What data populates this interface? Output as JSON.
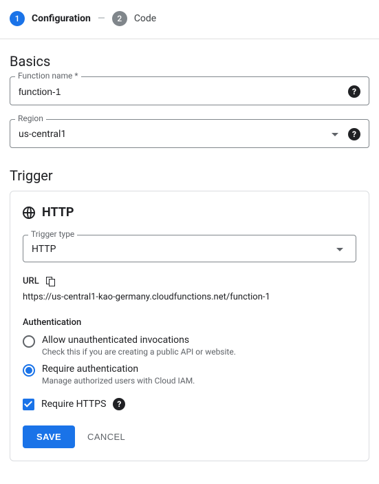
{
  "stepper": {
    "step1_num": "1",
    "step1_label": "Configuration",
    "step2_num": "2",
    "step2_label": "Code"
  },
  "basics": {
    "heading": "Basics",
    "function_name_label": "Function name *",
    "function_name_value": "function-1",
    "region_label": "Region",
    "region_value": "us-central1"
  },
  "trigger": {
    "heading": "Trigger",
    "card_title": "HTTP",
    "type_label": "Trigger type",
    "type_value": "HTTP",
    "url_label": "URL",
    "url_value": "https://us-central1-kao-germany.cloudfunctions.net/function-1",
    "auth_heading": "Authentication",
    "auth_allow_title": "Allow unauthenticated invocations",
    "auth_allow_desc": "Check this if you are creating a public API or website.",
    "auth_require_title": "Require authentication",
    "auth_require_desc": "Manage authorized users with Cloud IAM.",
    "require_https_label": "Require HTTPS"
  },
  "buttons": {
    "save": "SAVE",
    "cancel": "CANCEL"
  }
}
